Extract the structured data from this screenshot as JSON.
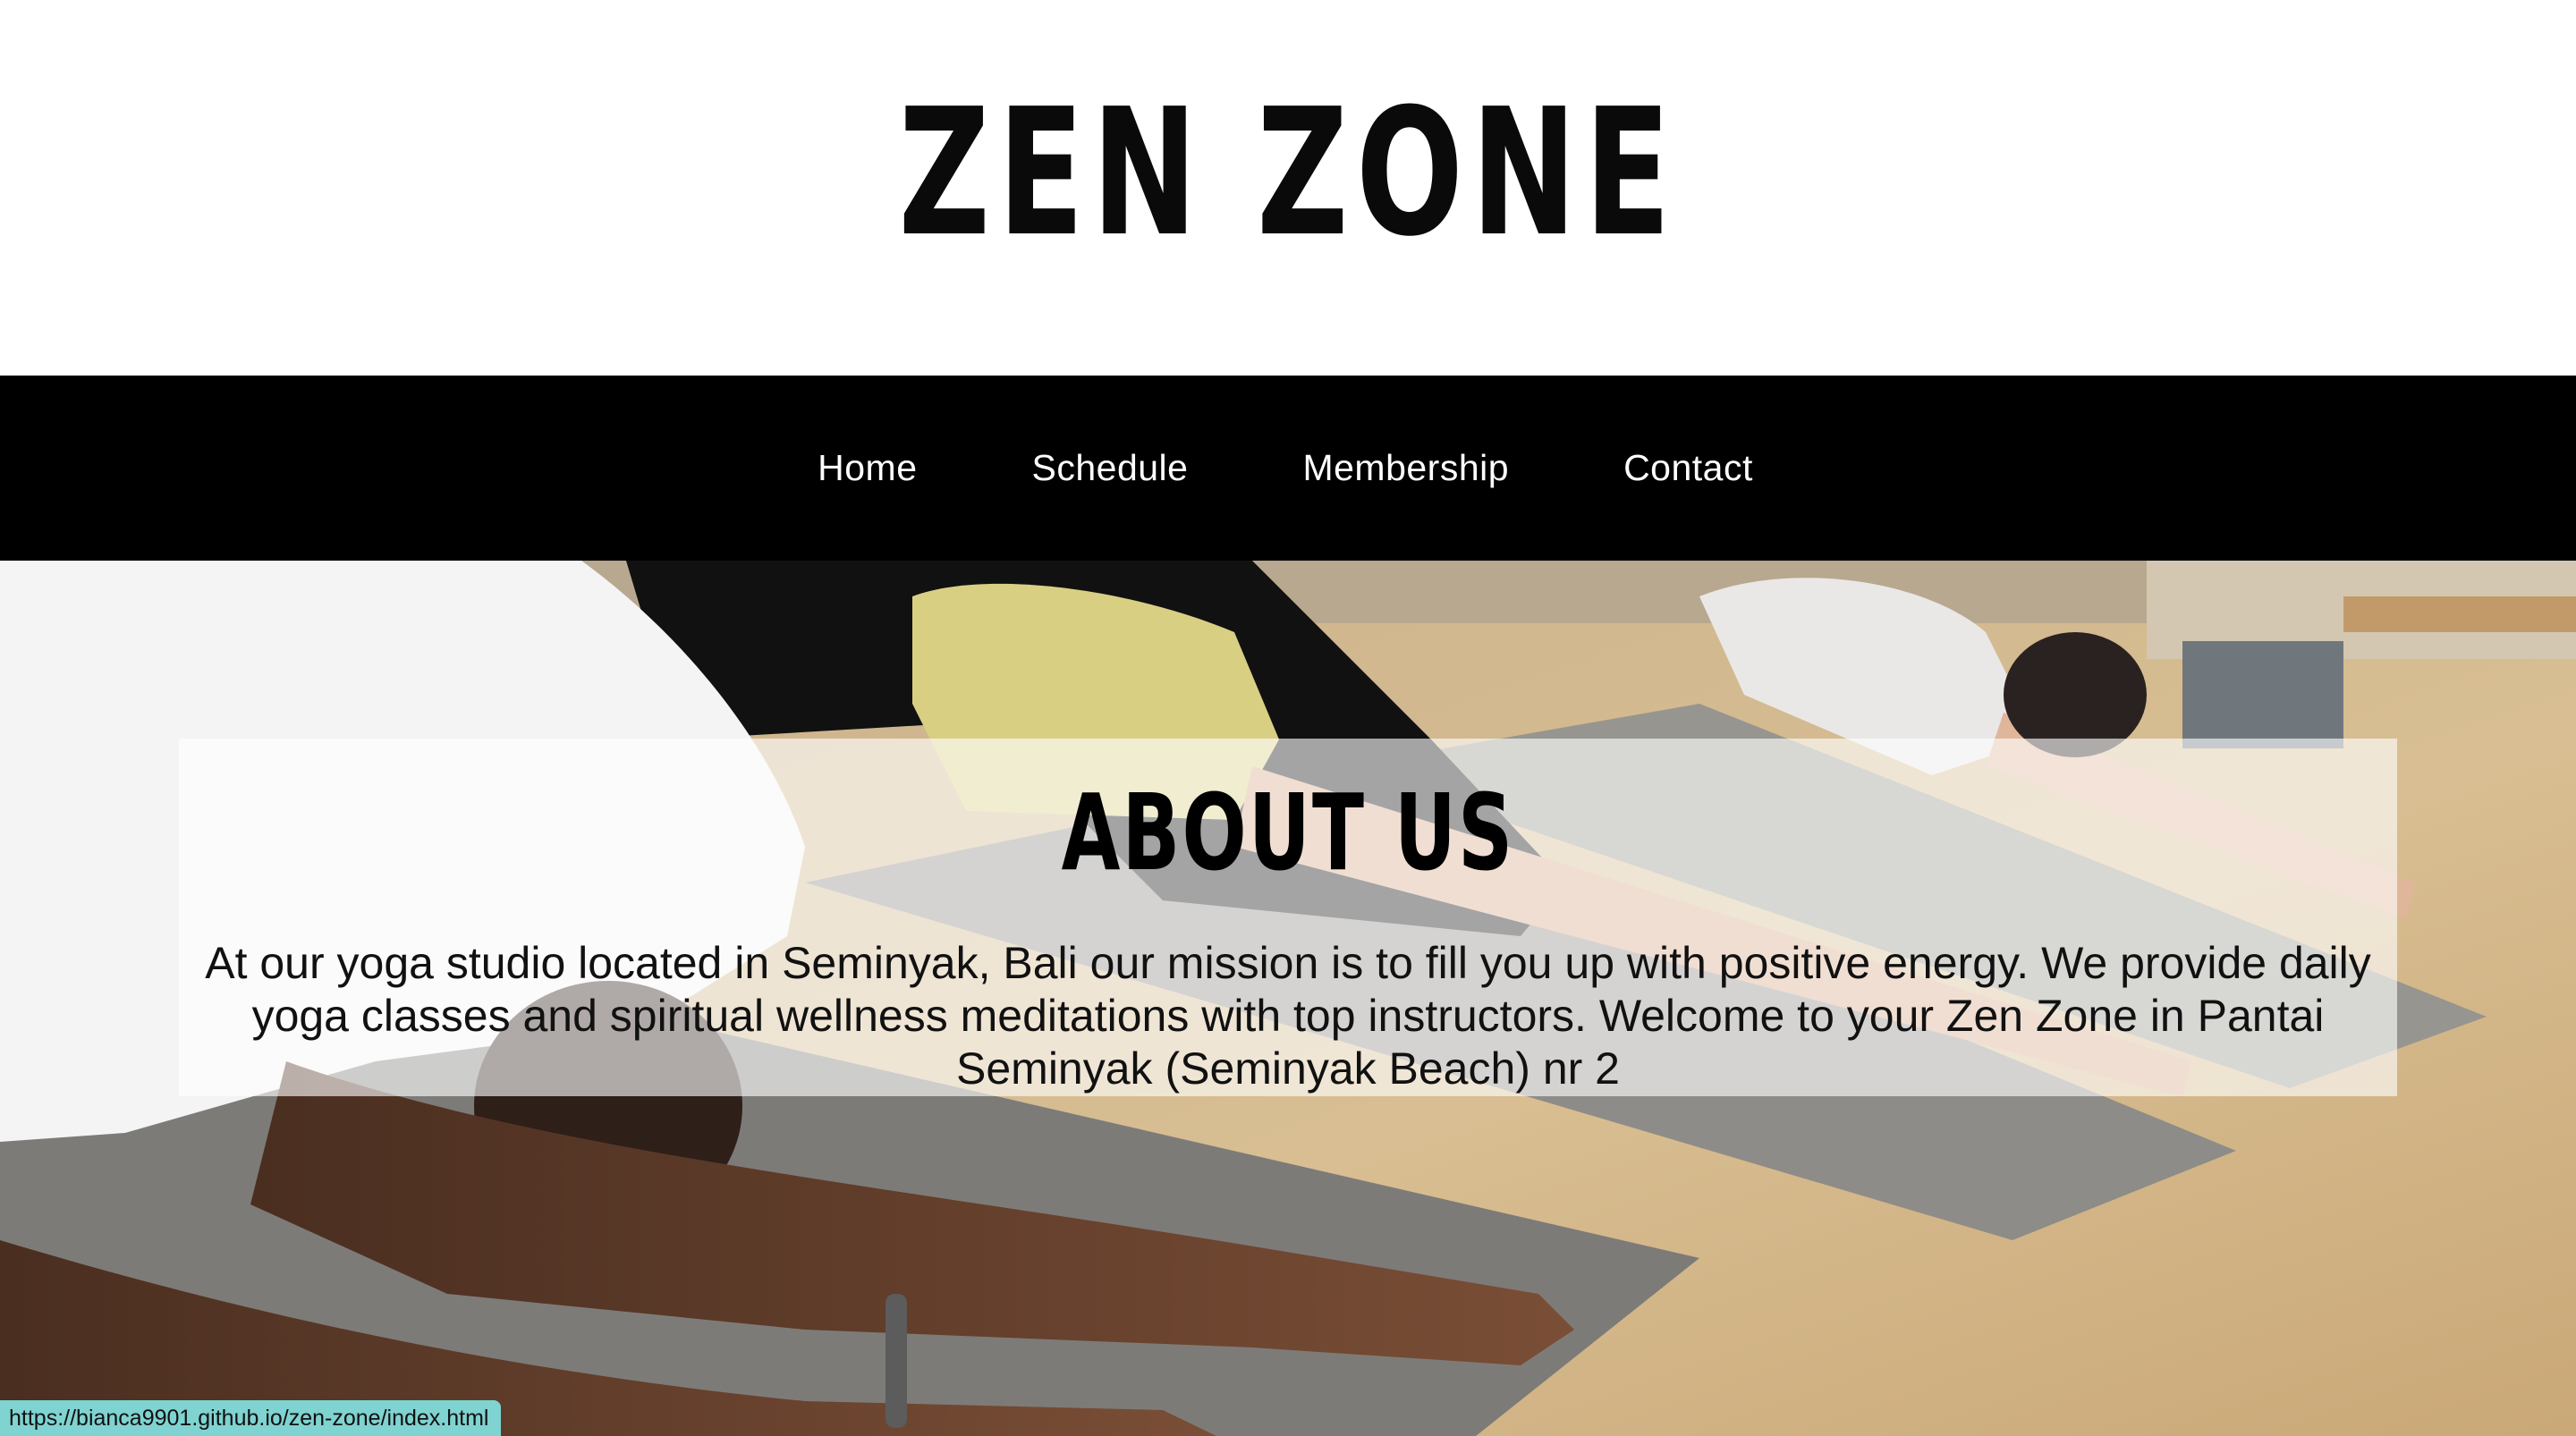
{
  "header": {
    "brand": "ZEN ZONE"
  },
  "nav": {
    "items": [
      {
        "label": "Home"
      },
      {
        "label": "Schedule"
      },
      {
        "label": "Membership"
      },
      {
        "label": "Contact"
      }
    ]
  },
  "about": {
    "title": "ABOUT US",
    "text": "At our yoga studio located in Seminyak, Bali our mission is to fill you up with positive energy. We provide daily yoga classes and spiritual wellness meditations with top instructors. Welcome to your Zen Zone in Pantai Seminyak (Seminyak Beach) nr 2"
  },
  "status_bar": {
    "url": "https://bianca9901.github.io/zen-zone/index.html"
  },
  "colors": {
    "nav_background": "#000000",
    "header_background": "#ffffff",
    "status_bar_background": "#7fd3d1"
  }
}
